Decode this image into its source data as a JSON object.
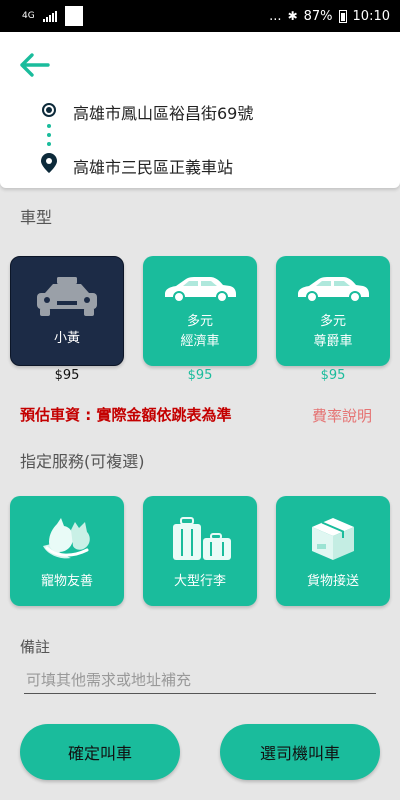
{
  "status_bar": {
    "network": "4G",
    "right_text": "...",
    "battery": "87%",
    "time": "10:10"
  },
  "route": {
    "origin": "高雄市鳳山區裕昌街69號",
    "destination": "高雄市三民區正義車站"
  },
  "car_type": {
    "label": "車型",
    "options": [
      {
        "line1": "小黃",
        "line2": "",
        "price": "$95",
        "selected": true
      },
      {
        "line1": "多元",
        "line2": "經濟車",
        "price": "$95",
        "selected": false
      },
      {
        "line1": "多元",
        "line2": "尊爵車",
        "price": "$95",
        "selected": false
      }
    ]
  },
  "estimate": {
    "text": "預估車資 : 實際金額依跳表為準",
    "rate_link": "費率說明"
  },
  "services": {
    "label": "指定服務(可複選)",
    "options": [
      {
        "label": "寵物友善",
        "icon": "pet-icon"
      },
      {
        "label": "大型行李",
        "icon": "luggage-icon"
      },
      {
        "label": "貨物接送",
        "icon": "package-icon"
      }
    ]
  },
  "note": {
    "label": "備註",
    "placeholder": "可填其他需求或地址補充"
  },
  "actions": {
    "confirm": "確定叫車",
    "choose_driver": "選司機叫車"
  },
  "colors": {
    "accent": "#1abc9c",
    "selected_tile": "#1c2b46",
    "warning": "#c40000",
    "link": "#e57373"
  }
}
